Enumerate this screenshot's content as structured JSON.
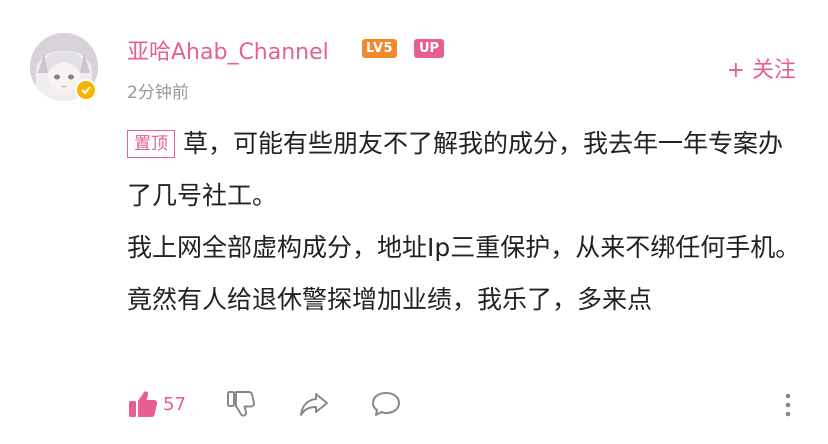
{
  "comment": {
    "author": {
      "name": "亚哈Ahab_Channel",
      "level_badge": "LV5",
      "up_badge": "UP",
      "avatar_icon": "anime-avatar",
      "avatar_badge_icon": "yellow-verified-badge"
    },
    "timestamp": "2分钟前",
    "follow_label": "+ 关注",
    "pin_tag": "置顶",
    "content": [
      "草，可能有些朋友不了解我的成分，我去年一年专案办了几号社工。",
      "我上网全部虚构成分，地址Ip三重保护，从来不绑任何手机。",
      "竟然有人给退休警探增加业绩，我乐了，多来点"
    ],
    "actions": {
      "likes": "57",
      "like_icon": "thumbs-up-icon",
      "dislike_icon": "thumbs-down-icon",
      "share_icon": "share-icon",
      "reply_icon": "comment-icon",
      "more_icon": "more-vertical-icon"
    },
    "colors": {
      "accent": "#e75f92",
      "level": "#f08a2d",
      "text": "#222222",
      "muted": "#999999"
    }
  }
}
